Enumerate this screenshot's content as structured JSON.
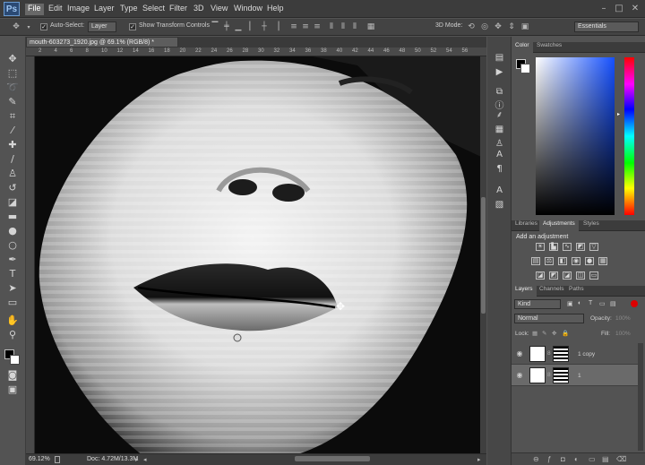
{
  "app": {
    "logo": "Ps"
  },
  "menu": [
    "File",
    "Edit",
    "Image",
    "Layer",
    "Type",
    "Select",
    "Filter",
    "3D",
    "View",
    "Window",
    "Help"
  ],
  "window_controls": [
    "–",
    "□",
    "✕"
  ],
  "options": {
    "auto_select_label": "Auto-Select:",
    "auto_select_value": "Layer",
    "show_transform": "Show Transform Controls",
    "mode_3d": "3D Mode:",
    "workspace": "Essentials"
  },
  "document": {
    "tab_title": "mouth-603273_1920.jpg @ 69.1% (RGB/8) *",
    "zoom": "69.12%",
    "doc_size": "Doc: 4.72M/13.3M"
  },
  "ruler_top": [
    "2",
    "4",
    "6",
    "8",
    "10",
    "12",
    "14",
    "16",
    "18",
    "20",
    "22",
    "24",
    "26",
    "28",
    "30",
    "32",
    "34",
    "36",
    "38",
    "40",
    "42",
    "44",
    "46",
    "48",
    "50",
    "52",
    "54",
    "56"
  ],
  "panels": {
    "color_tabs": [
      "Color",
      "Swatches"
    ],
    "adj_tabs": [
      "Libraries",
      "Adjustments",
      "Styles"
    ],
    "adj_heading": "Add an adjustment",
    "layer_tabs": [
      "Layers",
      "Channels",
      "Paths"
    ],
    "kind": "Kind",
    "blend_mode": "Normal",
    "opacity_label": "Opacity:",
    "opacity_value": "100%",
    "lock_label": "Lock:",
    "fill_label": "Fill:",
    "fill_value": "100%",
    "layers": [
      {
        "name": "1 copy"
      },
      {
        "name": "1"
      }
    ]
  },
  "colors": {
    "menubar": "#3c3c3c",
    "panel": "#535353",
    "accent": "#1550ff"
  }
}
